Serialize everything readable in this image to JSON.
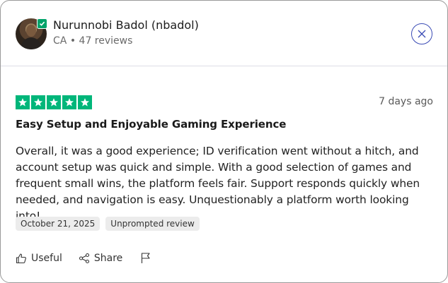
{
  "reviewer": {
    "name": "Nurunnobi Badol (nbadol)",
    "country": "CA",
    "separator": "•",
    "reviews_count": "47 reviews",
    "verified": true
  },
  "close_icon": "close-icon",
  "review": {
    "rating": 5,
    "max_rating": 5,
    "date_ago": "7 days ago",
    "title": "Easy Setup and Enjoyable Gaming Experience",
    "text": "Overall, it was a good experience; ID verification went without a hitch, and account setup was quick and simple. With a good selection of games and frequent small wins, the platform feels fair. Support responds quickly when needed, and navigation is easy. Unquestionably a platform worth looking into!",
    "date": "October 21, 2025",
    "tag": "Unprompted review"
  },
  "actions": {
    "useful_label": "Useful",
    "share_label": "Share"
  },
  "colors": {
    "star_green": "#00b67a",
    "verified_green": "#00a36a",
    "close_blue": "#3a4bb5"
  }
}
